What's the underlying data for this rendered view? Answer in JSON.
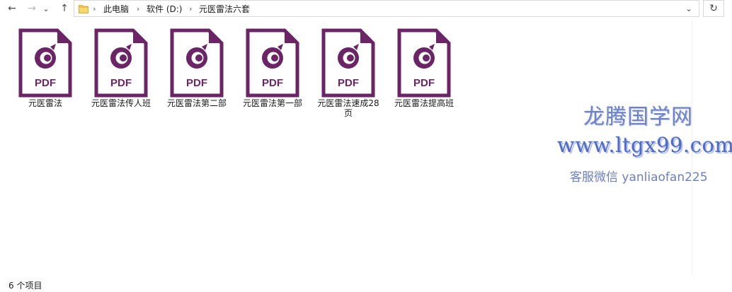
{
  "nav": {
    "back_glyph": "←",
    "forward_glyph": "→",
    "recent_glyph": "⌄",
    "up_glyph": "↑"
  },
  "address": {
    "crumbs": [
      "此电脑",
      "软件 (D:)",
      "元医雷法六套"
    ],
    "separator": "›",
    "dropdown_glyph": "⌄",
    "refresh_glyph": "↻"
  },
  "files": [
    {
      "name": "元医雷法",
      "badge": "PDF"
    },
    {
      "name": "元医雷法传人班",
      "badge": "PDF"
    },
    {
      "name": "元医雷法第二部",
      "badge": "PDF"
    },
    {
      "name": "元医雷法第一部",
      "badge": "PDF"
    },
    {
      "name": "元医雷法速成28页",
      "badge": "PDF"
    },
    {
      "name": "元医雷法提高班",
      "badge": "PDF"
    }
  ],
  "watermark": {
    "line1": "龙腾国学网",
    "line2": "www.ltgx99.com",
    "line3": "客服微信 yanliaofan225"
  },
  "status": {
    "item_count": "6 个项目"
  },
  "colors": {
    "pdf_purple": "#6b2465",
    "folder_yellow": "#f2c94c",
    "watermark_blue": "#5a72c8"
  },
  "icons": {
    "file": "foxit-pdf-file-icon",
    "folder": "folder-icon"
  }
}
